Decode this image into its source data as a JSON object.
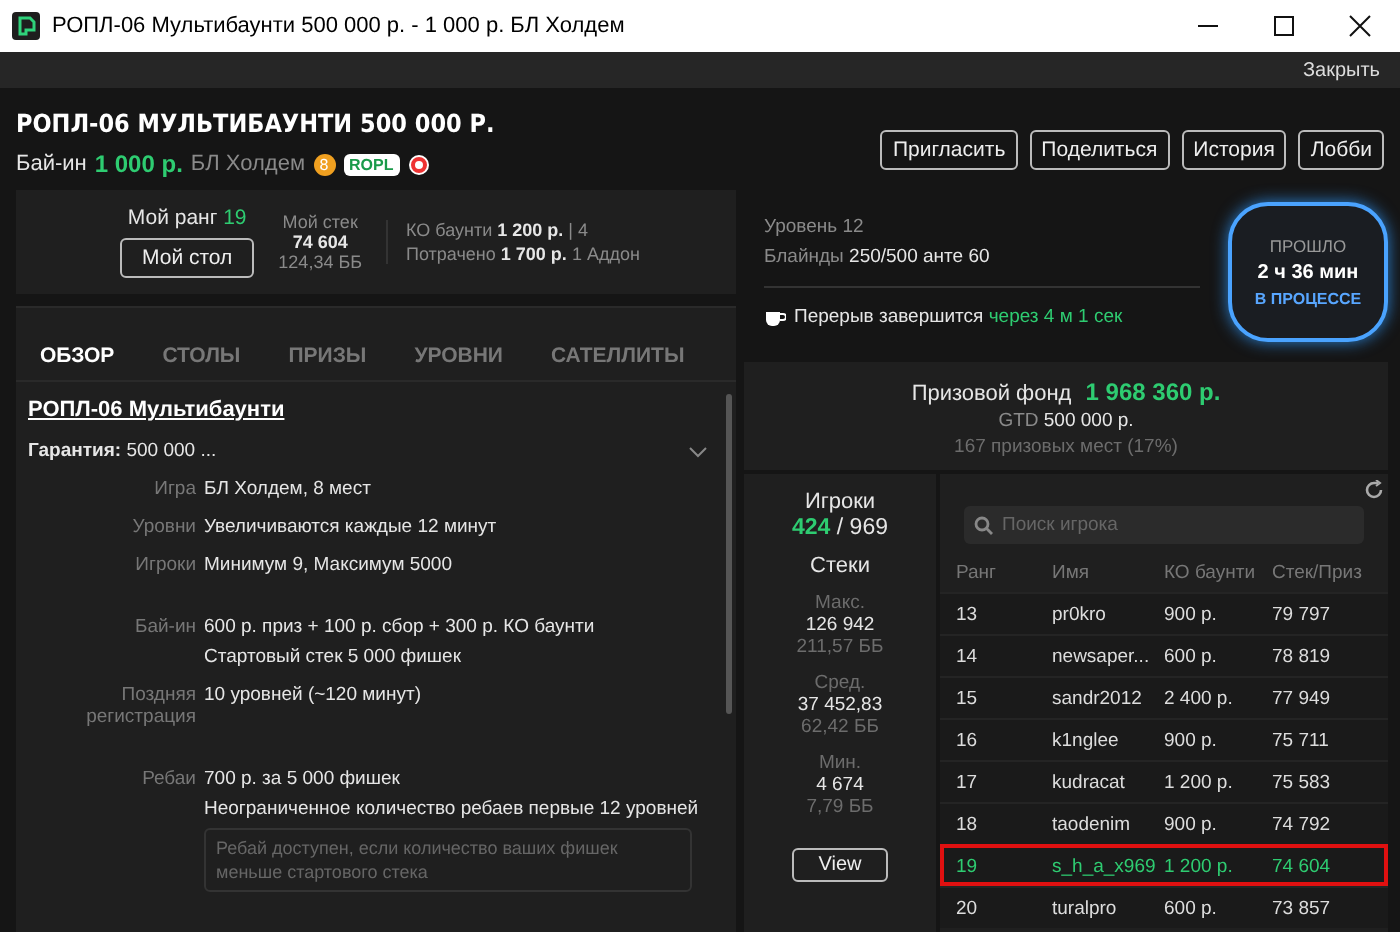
{
  "window": {
    "title": "РОПЛ-06 Мультибаунти 500 000 р. - 1 000 р. БЛ Холдем"
  },
  "toolbar": {
    "close_label": "Закрыть"
  },
  "header": {
    "title": "РОПЛ-06 МУЛЬТИБАУНТИ 500 000 Р.",
    "buyin_label": "Бай-ин",
    "buyin_value": "1 000 р.",
    "game": "БЛ Холдем",
    "badge_coin": "8",
    "badge_tag": "ROPL",
    "buttons": [
      "Пригласить",
      "Поделиться",
      "История",
      "Лобби"
    ]
  },
  "my_stats": {
    "rank_label": "Мой ранг",
    "rank_value": "19",
    "table_button": "Мой стол",
    "stack_label": "Мой стек",
    "stack_value": "74 604",
    "stack_bb": "124,34 ББ",
    "ko_label": "КО баунти",
    "ko_value": "1 200 р.",
    "ko_count": "| 4",
    "spent_label": "Потрачено",
    "spent_value": "1 700 р.",
    "spent_extra": "1 Аддон"
  },
  "tabs": [
    {
      "label": "ОБЗОР",
      "selected": true
    },
    {
      "label": "СТОЛЫ",
      "selected": false
    },
    {
      "label": "ПРИЗЫ",
      "selected": false
    },
    {
      "label": "УРОВНИ",
      "selected": false
    },
    {
      "label": "САТЕЛЛИТЫ",
      "selected": false
    }
  ],
  "overview": {
    "title": "РОПЛ-06 Мультибаунти",
    "guarantee_label": "Гарантия:",
    "guarantee_value": "500 000 ...",
    "rows": [
      {
        "label": "Игра",
        "lines": [
          "БЛ Холдем, 8 мест"
        ]
      },
      {
        "label": "Уровни",
        "lines": [
          "Увеличиваются каждые 12 минут"
        ]
      },
      {
        "label": "Игроки",
        "lines": [
          "Минимум 9, Максимум 5000"
        ]
      },
      {
        "label": "Бай-ин",
        "lines": [
          "600 р. приз + 100 р. сбор + 300 р. КО баунти",
          "Стартовый стек 5 000 фишек"
        ]
      },
      {
        "label": "Поздняя регистрация",
        "lines": [
          "10 уровней (~120 минут)"
        ]
      },
      {
        "label": "Ребаи",
        "lines": [
          "700 р. за 5 000 фишек",
          "Неограниченное количество ребаев первые 12 уровней"
        ],
        "note": "Ребай доступен, если количество ваших фишек меньше стартового стека"
      }
    ]
  },
  "level_info": {
    "level": "Уровень 12",
    "blinds_label": "Блайнды",
    "blinds_value": "250/500 анте 60",
    "break_text": "Перерыв завершится",
    "break_time": "через 4 м 1 сек"
  },
  "clock": {
    "label": "ПРОШЛО",
    "time": "2 ч 36 мин",
    "status": "В ПРОЦЕССЕ"
  },
  "prize": {
    "label": "Призовой фонд",
    "value": "1 968 360 р.",
    "gtd_label": "GTD",
    "gtd_value": "500 000 р.",
    "places": "167 призовых мест (17%)"
  },
  "players_summary": {
    "title": "Игроки",
    "remaining": "424",
    "total": "/ 969",
    "stacks_title": "Стеки",
    "stats": [
      {
        "label": "Макс.",
        "value": "126 942",
        "bb": "211,57 ББ"
      },
      {
        "label": "Сред.",
        "value": "37 452,83",
        "bb": "62,42 ББ"
      },
      {
        "label": "Мин.",
        "value": "4 674",
        "bb": "7,79 ББ"
      }
    ],
    "view_button": "View"
  },
  "players_table": {
    "search_placeholder": "Поиск игрока",
    "columns": [
      "Ранг",
      "Имя",
      "КО баунти",
      "Стек/Приз"
    ],
    "rows": [
      {
        "cells": [
          "13",
          "pr0kro",
          "900 р.",
          "79 797"
        ],
        "selected": false
      },
      {
        "cells": [
          "14",
          "newsaper...",
          "600 р.",
          "78 819"
        ],
        "selected": false
      },
      {
        "cells": [
          "15",
          "sandr2012",
          "2 400 р.",
          "77 949"
        ],
        "selected": false
      },
      {
        "cells": [
          "16",
          "k1nglee",
          "900 р.",
          "75 711"
        ],
        "selected": false
      },
      {
        "cells": [
          "17",
          "kudracat",
          "1 200 р.",
          "75 583"
        ],
        "selected": false
      },
      {
        "cells": [
          "18",
          "taodenim",
          "900 р.",
          "74 792"
        ],
        "selected": false
      },
      {
        "cells": [
          "19",
          "s_h_a_x969",
          "1 200 р.",
          "74 604"
        ],
        "selected": true
      },
      {
        "cells": [
          "20",
          "turalpro",
          "600 р.",
          "73 857"
        ],
        "selected": false
      }
    ]
  }
}
